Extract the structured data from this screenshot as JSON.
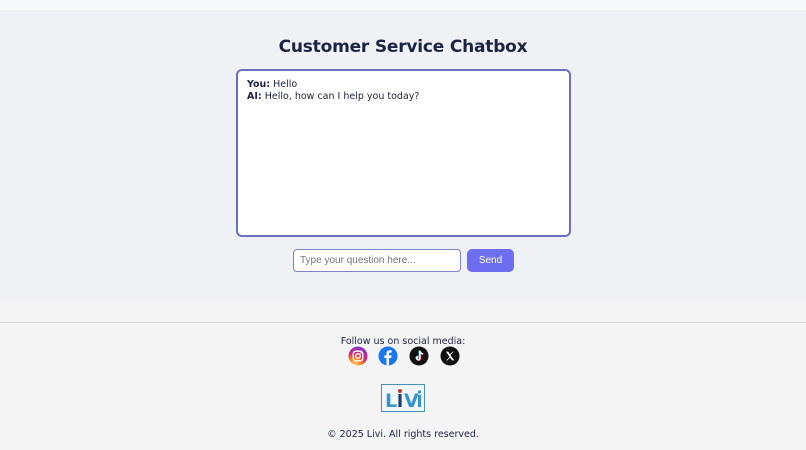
{
  "page": {
    "title": "Customer Service Chatbox"
  },
  "chat": {
    "messages": [
      {
        "speaker": "You:",
        "text": "Hello"
      },
      {
        "speaker": "AI:",
        "text": "Hello, how can I help you today?"
      }
    ]
  },
  "composer": {
    "placeholder": "Type your question here...",
    "value": "",
    "send_label": "Send"
  },
  "footer": {
    "follow_text": "Follow us on social media:",
    "social_icons": [
      "instagram-icon",
      "facebook-icon",
      "tiktok-icon",
      "x-icon"
    ],
    "logo_text": "LiVi",
    "copyright": "© 2025 Livi. All rights reserved."
  },
  "colors": {
    "accent": "#6e6ef0",
    "title": "#1d2340",
    "chat_border": "#6a6fc2",
    "facebook": "#1877f2",
    "logo": "#3a94c9"
  }
}
